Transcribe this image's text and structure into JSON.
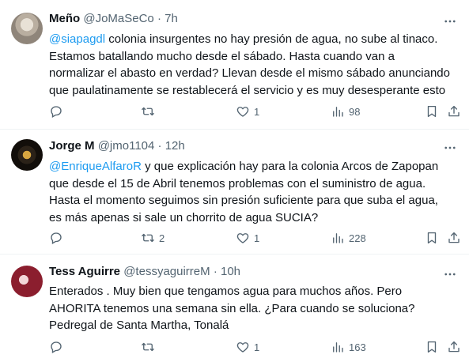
{
  "tweets": [
    {
      "name": "Meño",
      "handle": "@JoMaSeCo",
      "separator": "·",
      "time": "7h",
      "text_lines": [
        {
          "mention": "@siapagdl",
          "text": " colonia insurgentes no hay presión de agua, no sube al tinaco."
        },
        {
          "mention": "",
          "text": "Estamos batallando mucho desde el sábado.  Hasta cuando van a"
        },
        {
          "mention": "",
          "text": "normalizar el abasto en verdad? Llevan desde el mismo sábado anunciando"
        },
        {
          "mention": "",
          "text": "que paulatinamente se restablecerá el servicio y es muy desesperante esto"
        }
      ],
      "replies": "",
      "retweets": "",
      "likes": "1",
      "views": "98"
    },
    {
      "name": "Jorge M",
      "handle": "@jmo1104",
      "separator": "·",
      "time": "12h",
      "text_lines": [
        {
          "mention": "@EnriqueAlfaroR",
          "text": " y que explicación hay para la colonia Arcos de Zapopan"
        },
        {
          "mention": "",
          "text": "que desde el 15 de Abril tenemos problemas con el suministro de agua."
        },
        {
          "mention": "",
          "text": "Hasta el momento seguimos sin presión suficiente para que suba el agua,"
        },
        {
          "mention": "",
          "text": "es más apenas si sale un chorrito de agua SUCIA?"
        }
      ],
      "replies": "",
      "retweets": "2",
      "likes": "1",
      "views": "228"
    },
    {
      "name": "Tess Aguirre",
      "handle": "@tessyaguirreM",
      "separator": "·",
      "time": "10h",
      "text_lines": [
        {
          "mention": "",
          "text": "Enterados . Muy bien que tengamos agua para muchos años. Pero"
        },
        {
          "mention": "",
          "text": "AHORITA  tenemos una semana sin ella. ¿Para cuando se soluciona?"
        },
        {
          "mention": "",
          "text": "Pedregal de Santa Martha, Tonalá"
        }
      ],
      "replies": "",
      "retweets": "",
      "likes": "1",
      "views": "163"
    }
  ],
  "icons": {
    "reply": "reply-icon",
    "retweet": "retweet-icon",
    "like": "heart-icon",
    "views": "views-icon",
    "bookmark": "bookmark-icon",
    "share": "share-icon",
    "more": "more-icon"
  },
  "colors": {
    "link": "#1d9bf0",
    "muted": "#536471",
    "text": "#0f1419",
    "divider": "#eff3f4"
  }
}
